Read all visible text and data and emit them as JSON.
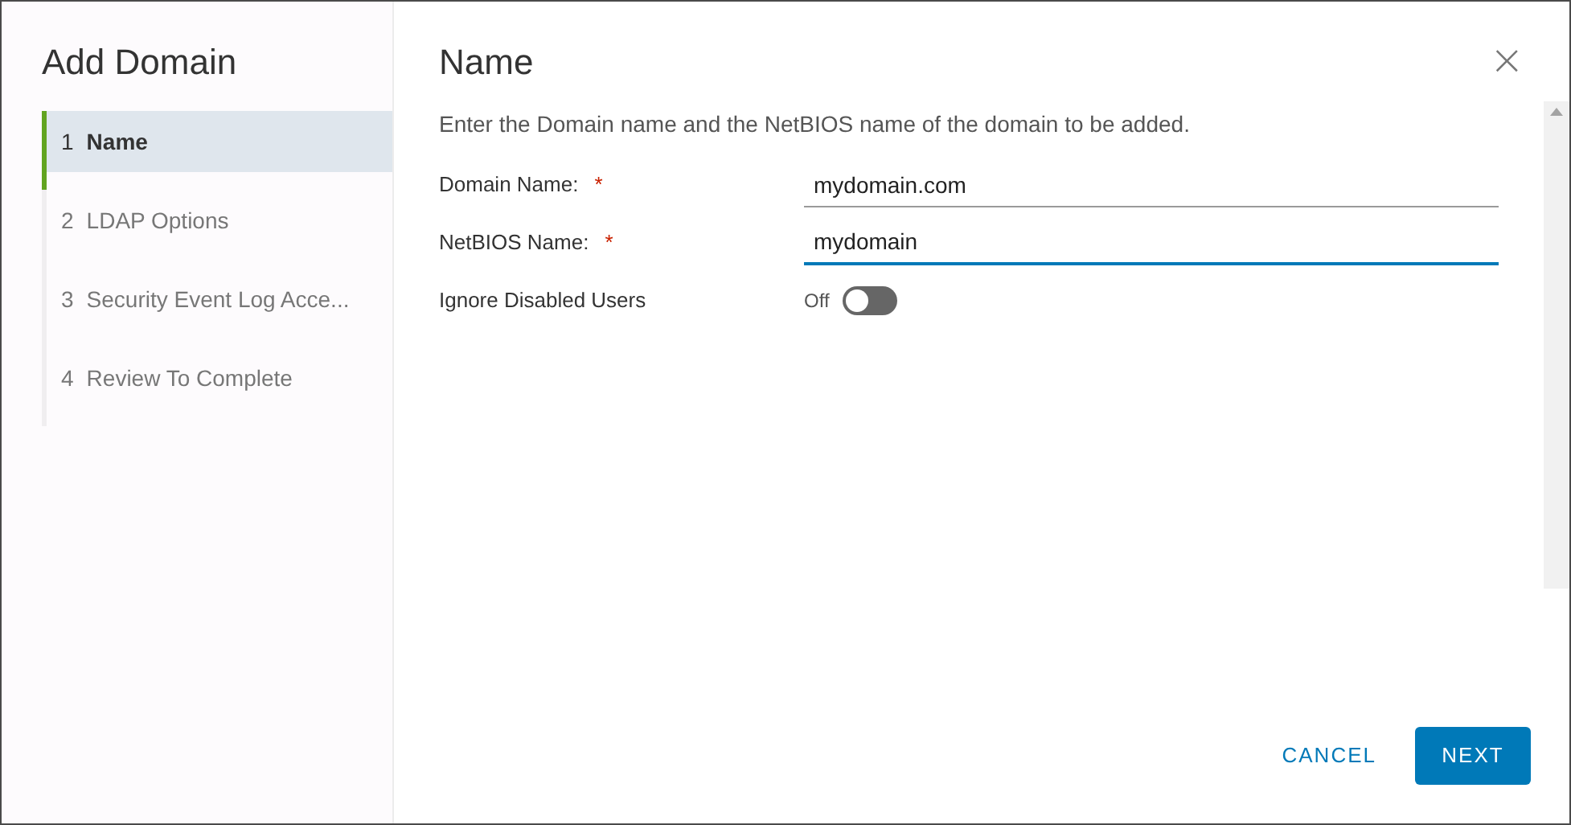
{
  "wizard": {
    "title": "Add Domain",
    "steps": [
      {
        "number": "1",
        "label": "Name",
        "selected": true
      },
      {
        "number": "2",
        "label": "LDAP Options",
        "selected": false
      },
      {
        "number": "3",
        "label": "Security Event Log Acce...",
        "selected": false
      },
      {
        "number": "4",
        "label": "Review To Complete",
        "selected": false
      }
    ]
  },
  "page": {
    "title": "Name",
    "close": "×",
    "description": "Enter the Domain name and the NetBIOS name of the domain to be added.",
    "fields": [
      {
        "kind": "text",
        "label": "Domain Name:",
        "required": "*",
        "value": "mydomain.com",
        "focused": false
      },
      {
        "kind": "text",
        "label": "NetBIOS Name:",
        "required": "*",
        "value": "mydomain",
        "focused": true
      },
      {
        "kind": "toggle",
        "label": "Ignore Disabled Users",
        "state_label": "Off",
        "on": false
      }
    ]
  },
  "buttons": {
    "cancel": "CANCEL",
    "next": "NEXT"
  }
}
